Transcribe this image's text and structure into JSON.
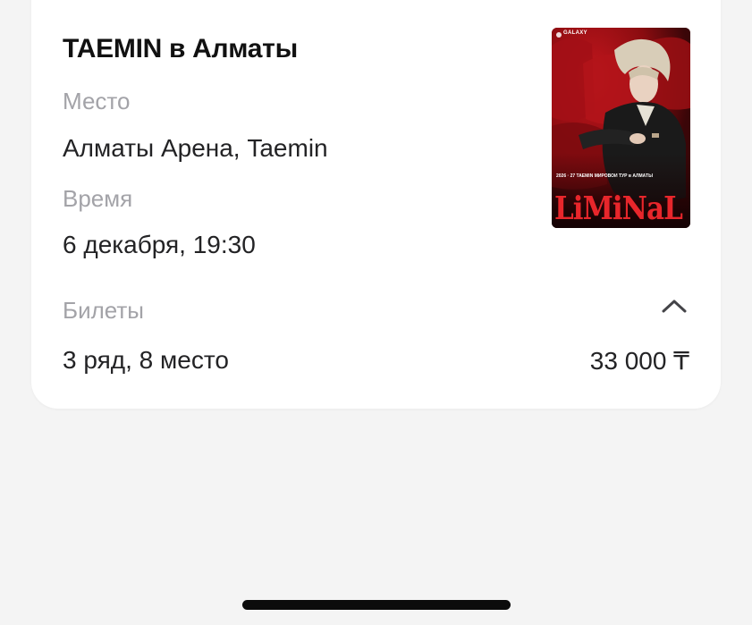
{
  "event": {
    "title": "TAEMIN в Алматы",
    "place_label": "Место",
    "place_value": "Алматы Арена, Taemin",
    "time_label": "Время",
    "time_value": "6 декабря, 19:30",
    "tickets_label": "Билеты",
    "ticket_seat": "3 ряд, 8 место",
    "ticket_price": "33 000 ₸"
  },
  "poster": {
    "logo_text": "GALAXY",
    "headline": "2026 · 27  TAEMIN  МИРОВОЙ ТУР в АЛМАТЫ",
    "brand": "LiMiNaL",
    "colors": {
      "background": "#4a0a0c",
      "seat_red": "#b01218",
      "brand_red": "#e8262b"
    }
  },
  "icons": {
    "collapse": "chevron-up-icon"
  },
  "colors": {
    "page_background": "#f4f4f4",
    "card_background": "#ffffff",
    "primary_text": "#111111",
    "secondary_text": "#a3a3a8"
  }
}
